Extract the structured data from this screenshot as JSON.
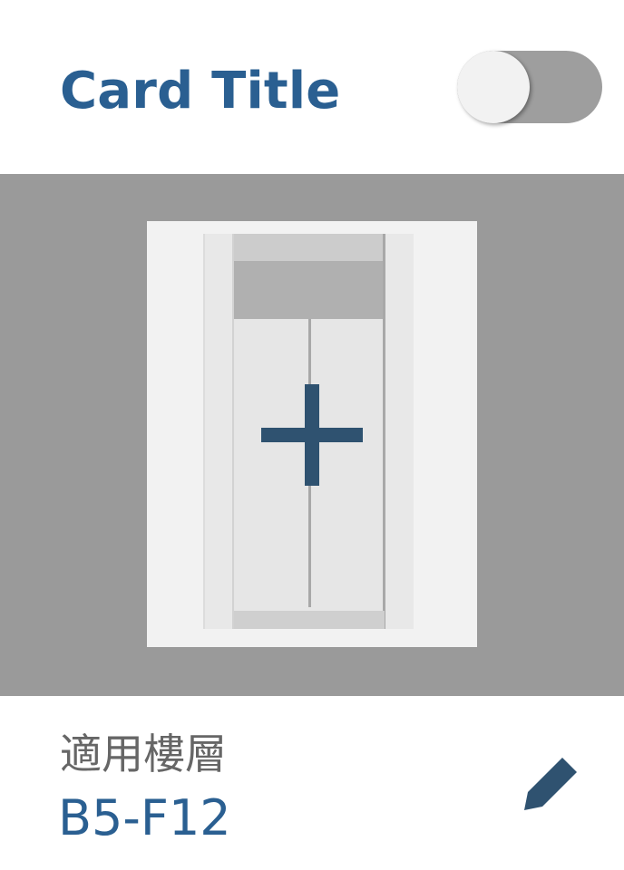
{
  "card": {
    "title": "Card Title",
    "toggle": {
      "checked": true
    },
    "image": {
      "icon": "add-icon",
      "illustration": "elevator-door"
    },
    "floors": {
      "label": "適用樓層",
      "value": "B5-F12"
    },
    "edit_icon": "pencil-icon"
  },
  "colors": {
    "title": "#2a5f91",
    "label": "#666666",
    "value": "#2a5f91",
    "toggle_track": "#9e9e9e",
    "toggle_thumb": "#f2f2f2",
    "image_bg": "#9a9a9a",
    "icon": "#2f5270"
  }
}
